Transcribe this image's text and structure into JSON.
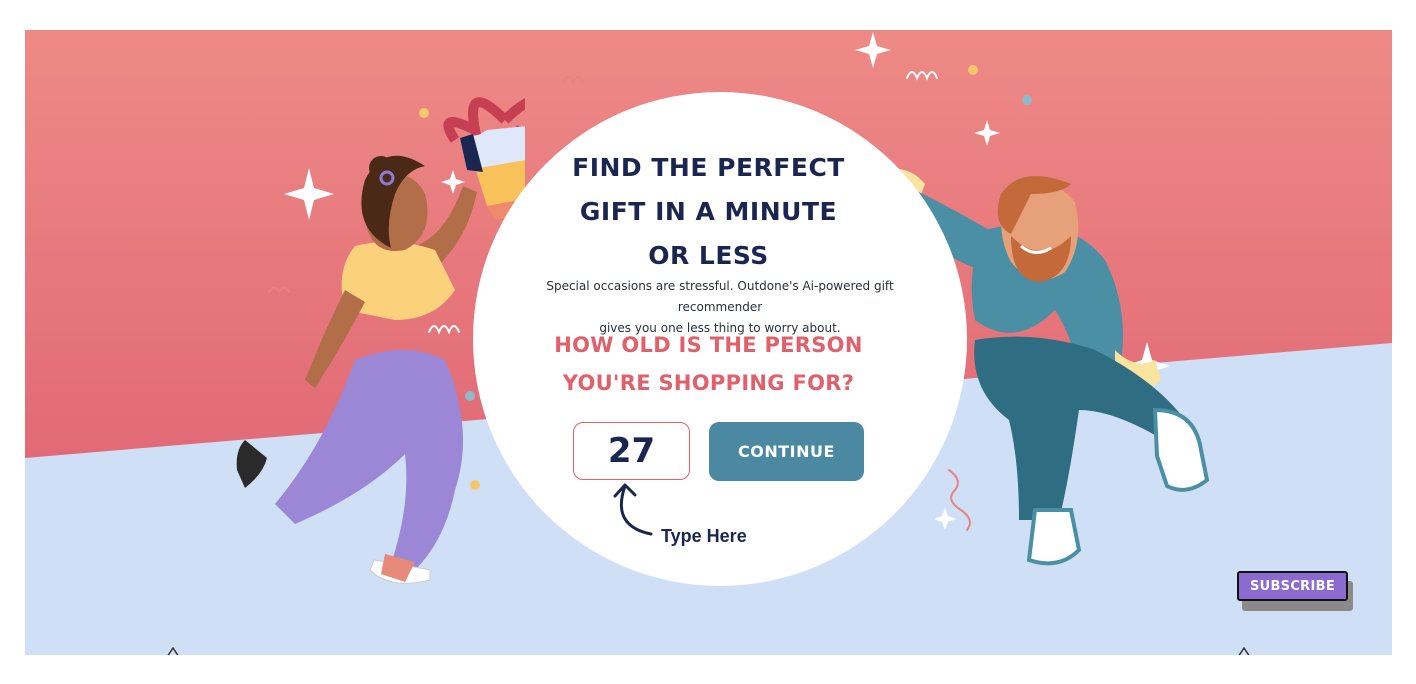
{
  "hero": {
    "headline_lines": [
      "Find the perfect",
      "gift in a minute",
      "or less"
    ],
    "subtext_lines": [
      "Special occasions are stressful. Outdone's Ai-powered gift recommender",
      "gives you one less thing to worry about."
    ],
    "question_lines": [
      "How old is the person",
      "you're shopping for?"
    ],
    "age_input": {
      "value": "27"
    },
    "continue_label": "CONTINUE",
    "hint_label": "Type Here"
  },
  "subscribe_label": "SUBSCRIBE",
  "colors": {
    "top_gradient_start": "#ee8a86",
    "top_gradient_end": "#e16a76",
    "floor": "#cfe0f6",
    "navy": "#1b2650",
    "accent_red": "#e0606c",
    "button_teal": "#4a89a1",
    "subscribe_purple": "#8c6bd0"
  },
  "icons": [
    "sparkle-icon",
    "confetti-icon",
    "gift-box-icon",
    "curved-arrow-icon"
  ]
}
